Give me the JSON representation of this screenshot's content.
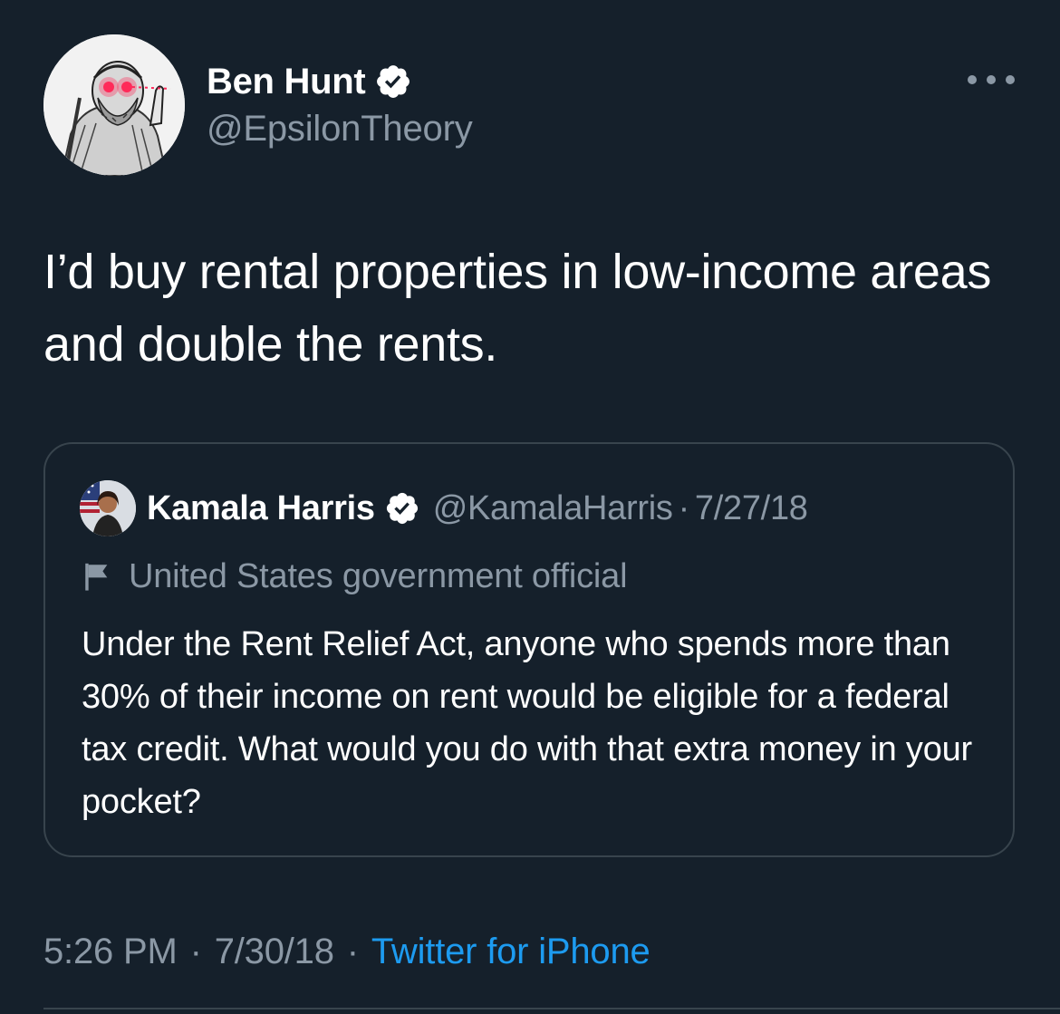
{
  "tweet": {
    "author": {
      "name": "Ben Hunt",
      "handle": "@EpsilonTheory",
      "verified": true,
      "avatar_icon": "engraved-philosopher-portrait-with-laser-eyes"
    },
    "more_icon": "more-horizontal-icon",
    "text": "I’d buy rental properties in low-income areas and double the rents.",
    "quote": {
      "author": {
        "name": "Kamala Harris",
        "handle": "@KamalaHarris",
        "verified": true,
        "avatar_icon": "profile-photo"
      },
      "separator": "·",
      "date": "7/27/18",
      "label": "United States government official",
      "label_icon": "flag-icon",
      "text": "Under the Rent Relief Act, anyone who spends more than 30% of their income on rent would be eligible for a federal tax credit. What would you do with that extra money in your pocket?"
    },
    "meta": {
      "time": "5:26 PM",
      "separator": "·",
      "date": "7/30/18",
      "source": "Twitter for iPhone"
    }
  },
  "colors": {
    "background": "#15202b",
    "text": "#ffffff",
    "secondary_text": "#8b98a5",
    "link": "#1d9bf0",
    "border": "#38444d"
  }
}
